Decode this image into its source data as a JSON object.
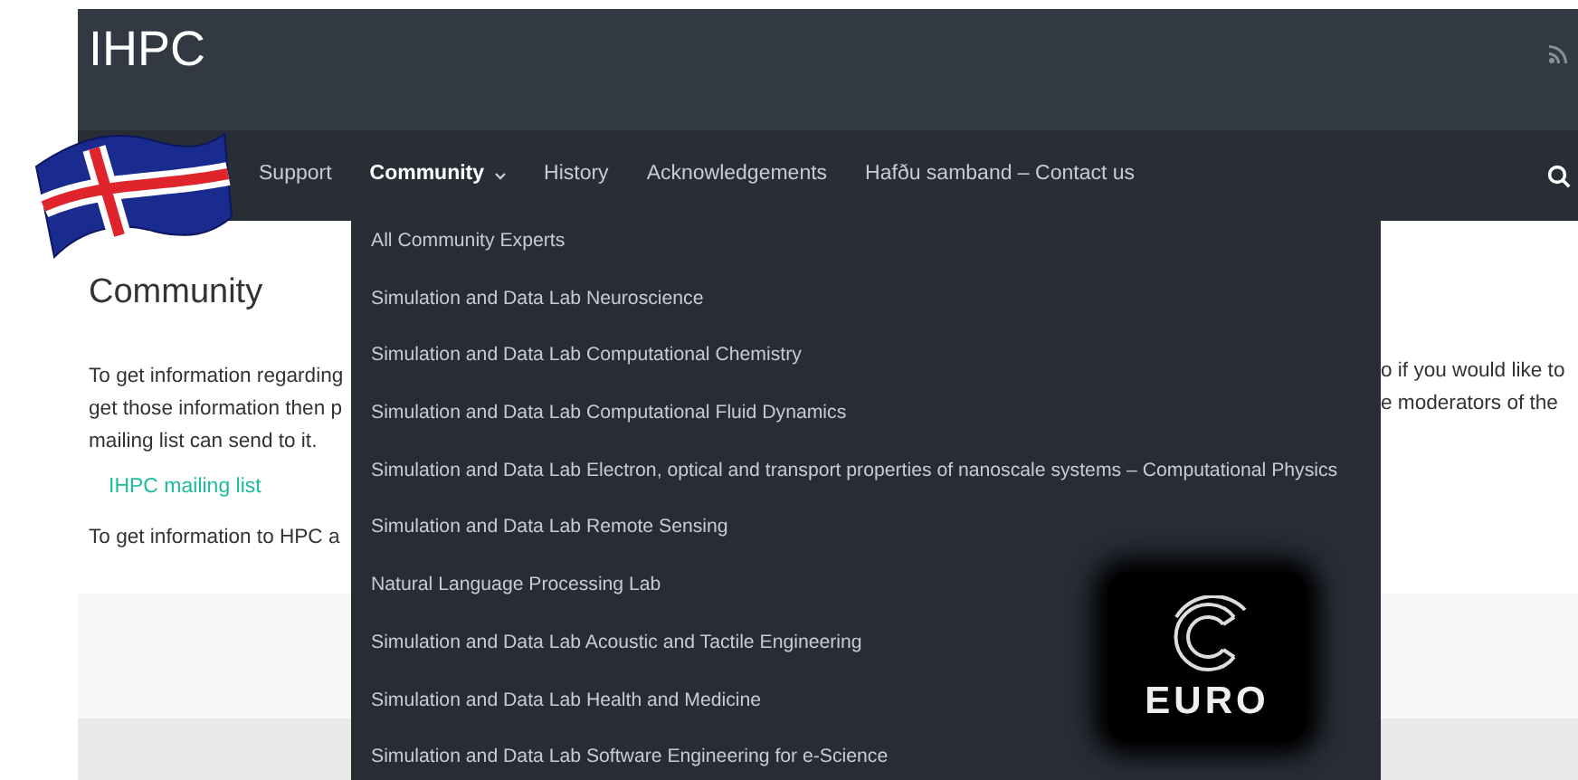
{
  "header": {
    "title": "IHPC"
  },
  "nav": {
    "items": [
      {
        "label": "Support",
        "selected": false,
        "has_menu": false
      },
      {
        "label": "Community",
        "selected": true,
        "has_menu": true
      },
      {
        "label": "History",
        "selected": false,
        "has_menu": false
      },
      {
        "label": "Acknowledgements",
        "selected": false,
        "has_menu": false
      },
      {
        "label": "Hafðu samband – Contact us",
        "selected": false,
        "has_menu": false
      }
    ]
  },
  "dropdown": {
    "items": [
      "All Community Experts",
      "Simulation and Data Lab Neuroscience",
      "Simulation and Data Lab Computational Chemistry",
      "Simulation and Data Lab Computational Fluid Dynamics",
      "Simulation and Data Lab Electron, optical and transport properties of nanoscale systems – Computational Physics",
      "Simulation and Data Lab Remote Sensing",
      "Natural Language Processing Lab",
      "Simulation and Data Lab Acoustic and Tactile Engineering",
      "Simulation and Data Lab Health and Medicine",
      "Simulation and Data Lab Software Engineering for e-Science"
    ]
  },
  "page": {
    "heading": "Community",
    "left_lines": [
      "To get information regarding",
      "get those information then p",
      "mailing list can send to it."
    ],
    "link": "IHPC mailing list",
    "left_after": "To get information to HPC a",
    "right_lines": [
      "o if you would like to",
      "e moderators of the"
    ]
  },
  "logo": {
    "text": "EURO"
  }
}
